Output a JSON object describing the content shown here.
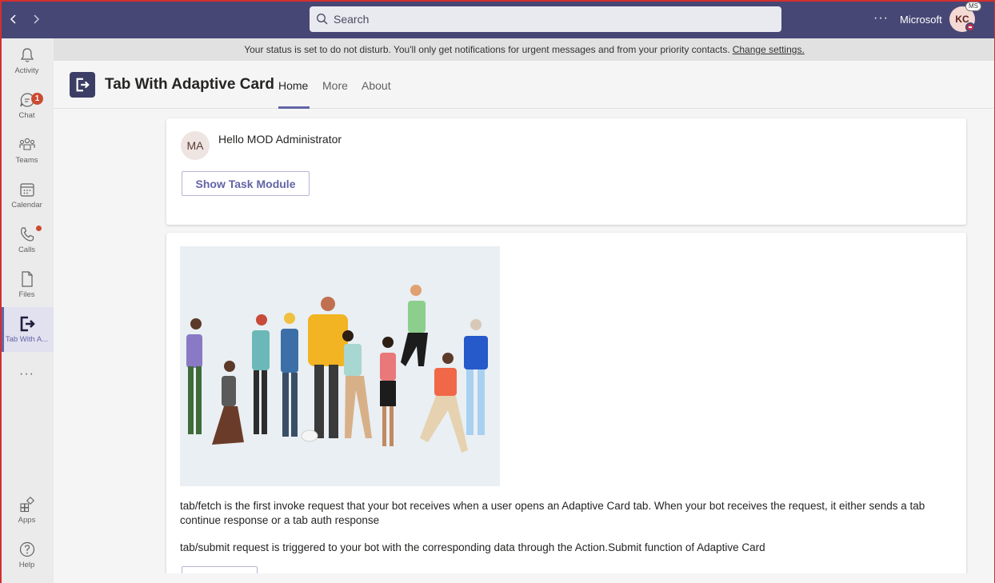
{
  "titlebar": {
    "search_placeholder": "Search",
    "org_name": "Microsoft",
    "avatar_initials": "KC",
    "avatar_badge": "MS",
    "more_label": "···"
  },
  "rail": {
    "items": [
      {
        "label": "Activity",
        "icon": "bell-icon"
      },
      {
        "label": "Chat",
        "icon": "chat-icon",
        "badge": "1"
      },
      {
        "label": "Teams",
        "icon": "teams-icon"
      },
      {
        "label": "Calendar",
        "icon": "calendar-icon"
      },
      {
        "label": "Calls",
        "icon": "phone-icon"
      },
      {
        "label": "Files",
        "icon": "file-icon"
      },
      {
        "label": "Tab With A...",
        "icon": "app-exit-icon",
        "active": true
      }
    ],
    "more": "···",
    "bottom": [
      {
        "label": "Apps",
        "icon": "apps-icon"
      },
      {
        "label": "Help",
        "icon": "help-icon"
      }
    ]
  },
  "status": {
    "message": "Your status is set to do not disturb. You'll only get notifications for urgent messages and from your priority contacts.",
    "link": "Change settings."
  },
  "app": {
    "title": "Tab With Adaptive Card",
    "tabs": [
      {
        "label": "Home",
        "active": true
      },
      {
        "label": "More"
      },
      {
        "label": "About"
      }
    ]
  },
  "card1": {
    "initials": "MA",
    "greeting": "Hello MOD Administrator",
    "button": "Show Task Module"
  },
  "card2": {
    "para1": "tab/fetch is the first invoke request that your bot receives when a user opens an Adaptive Card tab. When your bot receives the request, it either sends a tab continue response or a tab auth response",
    "para2": "tab/submit request is triggered to your bot with the corresponding data through the Action.Submit function of Adaptive Card"
  },
  "colors": {
    "titlebar": "#464775",
    "accent": "#6264a7",
    "badge": "#cc4a31",
    "dnd": "#c4314b"
  }
}
